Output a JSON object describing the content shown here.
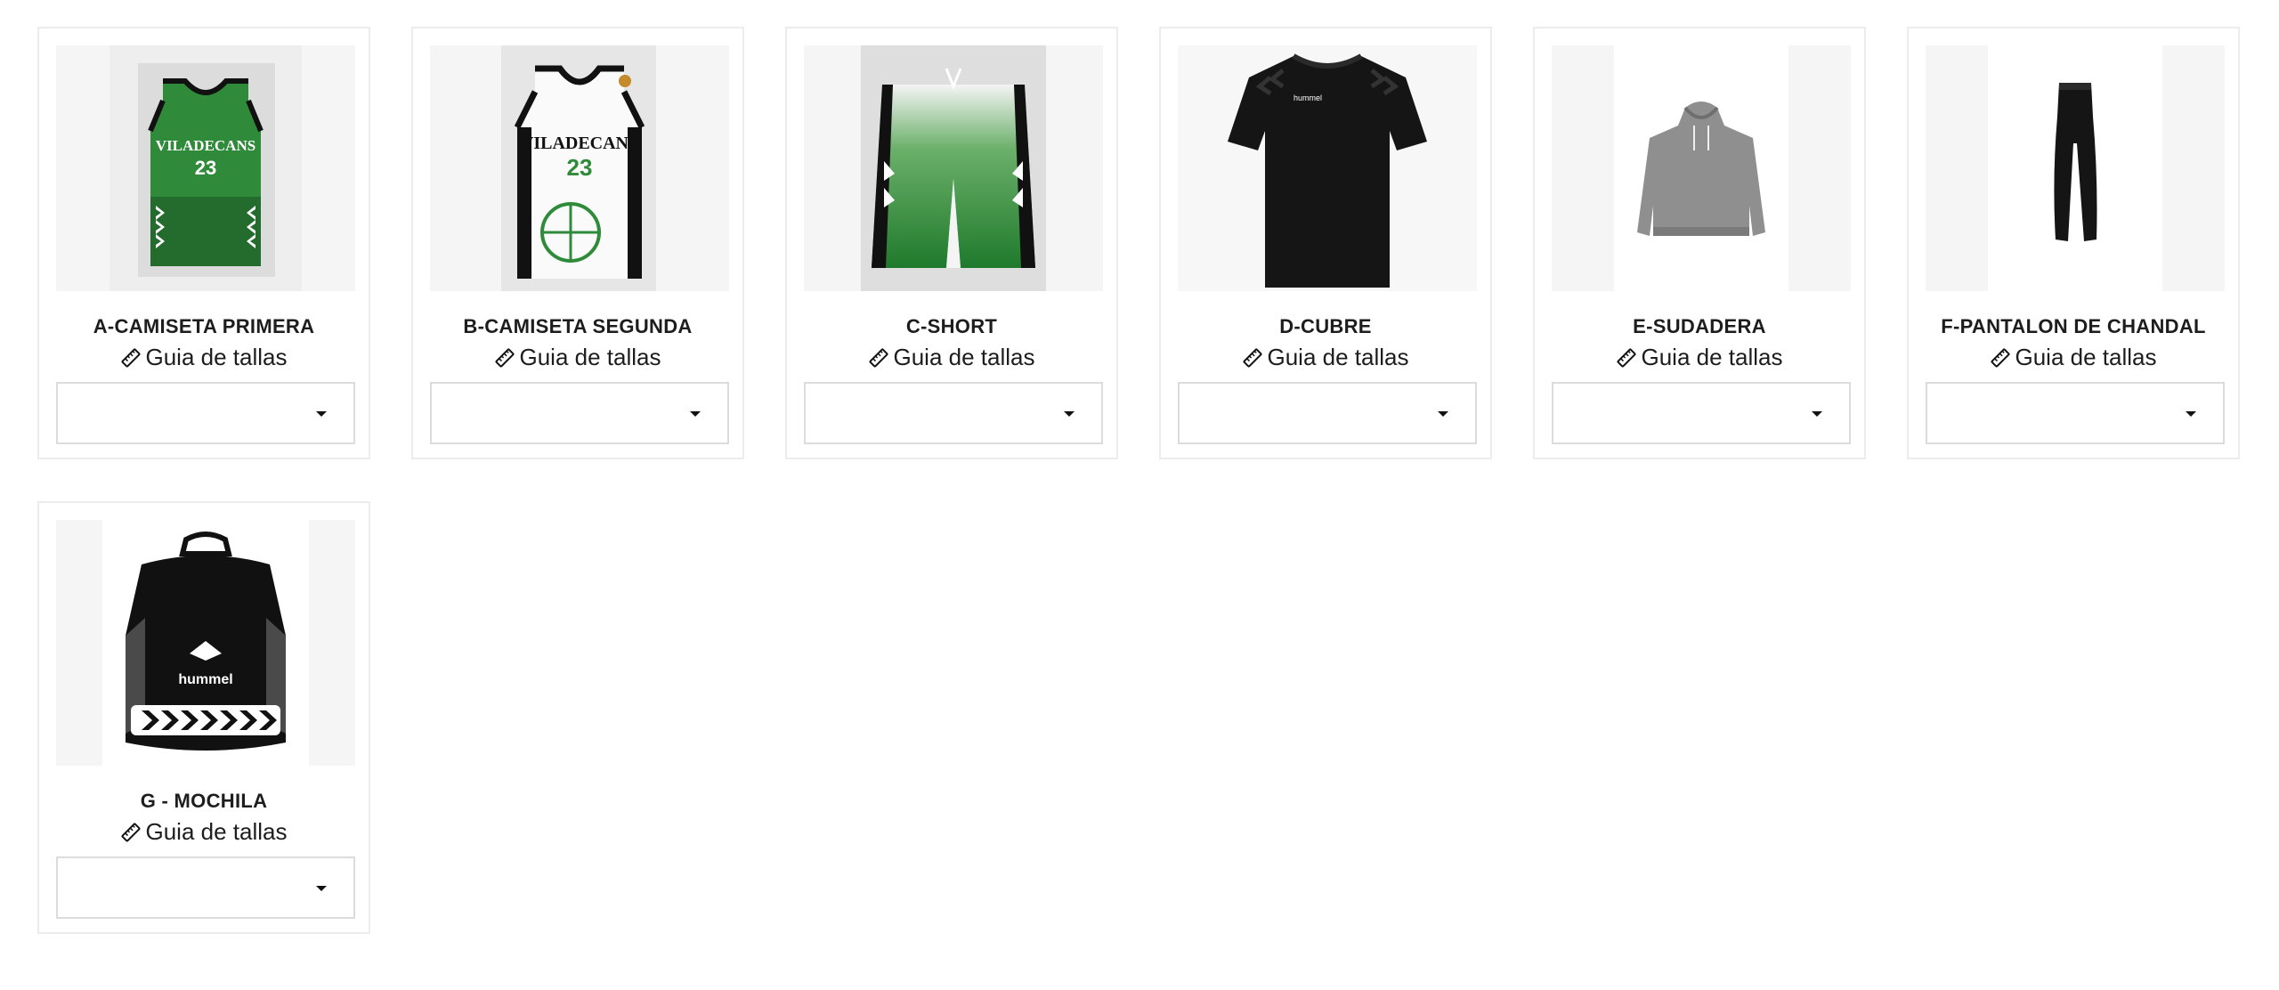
{
  "products": [
    {
      "name": "A-CAMISETA PRIMERA",
      "size_guide": "Guia de tallas",
      "select_value": "",
      "image": "green-basketball-jersey-23"
    },
    {
      "name": "B-CAMISETA SEGUNDA",
      "size_guide": "Guia de tallas",
      "select_value": "",
      "image": "white-basketball-jersey-23"
    },
    {
      "name": "C-SHORT",
      "size_guide": "Guia de tallas",
      "select_value": "",
      "image": "green-basketball-shorts"
    },
    {
      "name": "D-CUBRE",
      "size_guide": "Guia de tallas",
      "select_value": "",
      "image": "black-tshirt"
    },
    {
      "name": "E-SUDADERA",
      "size_guide": "Guia de tallas",
      "select_value": "",
      "image": "grey-hoodie"
    },
    {
      "name": "F-PANTALON DE CHANDAL",
      "size_guide": "Guia de tallas",
      "select_value": "",
      "image": "black-track-pants"
    },
    {
      "name": "G - MOCHILA",
      "size_guide": "Guia de tallas",
      "select_value": "",
      "image": "black-backpack"
    }
  ],
  "jersey_text": {
    "team": "VILADECANS",
    "number": "23",
    "brand": "hummel"
  },
  "colors": {
    "green": "#2f8a3a",
    "black": "#111111",
    "border": "#ececec",
    "image_bg": "#f5f5f5"
  }
}
